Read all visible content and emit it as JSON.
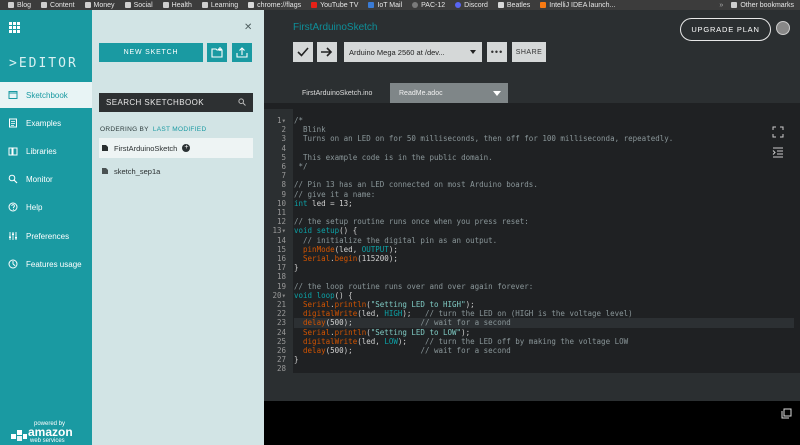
{
  "bookmarks": {
    "items": [
      {
        "label": "Blog",
        "icon": "folder-icon"
      },
      {
        "label": "Content",
        "icon": "folder-icon"
      },
      {
        "label": "Money",
        "icon": "folder-icon"
      },
      {
        "label": "Social",
        "icon": "folder-icon"
      },
      {
        "label": "Health",
        "icon": "folder-icon"
      },
      {
        "label": "Learning",
        "icon": "folder-icon"
      },
      {
        "label": "chrome://flags",
        "icon": "flask-icon"
      },
      {
        "label": "YouTube TV",
        "icon": "youtube-icon"
      },
      {
        "label": "IoT Mail",
        "icon": "mail-icon"
      },
      {
        "label": "PAC-12",
        "icon": "pac12-icon"
      },
      {
        "label": "Discord",
        "icon": "discord-icon"
      },
      {
        "label": "Beatles",
        "icon": "page-icon"
      },
      {
        "label": "IntelliJ IDEA launch...",
        "icon": "intellij-icon"
      }
    ],
    "overflow": "»",
    "other": "Other bookmarks"
  },
  "nav": {
    "brand": "EDITOR",
    "items": [
      {
        "label": "Sketchbook",
        "icon": "sketchbook-icon",
        "active": true
      },
      {
        "label": "Examples",
        "icon": "examples-icon",
        "active": false
      },
      {
        "label": "Libraries",
        "icon": "libraries-icon",
        "active": false
      },
      {
        "label": "Monitor",
        "icon": "monitor-icon",
        "active": false
      },
      {
        "label": "Help",
        "icon": "help-icon",
        "active": false
      },
      {
        "label": "Preferences",
        "icon": "preferences-icon",
        "active": false
      },
      {
        "label": "Features usage",
        "icon": "features-icon",
        "active": false
      }
    ],
    "aws": {
      "powered": "powered by",
      "brand": "amazon",
      "sub": "web services"
    }
  },
  "sidebar": {
    "close": "✕",
    "new_sketch": "NEW SKETCH",
    "search_placeholder": "SEARCH SKETCHBOOK",
    "ordering_label": "ORDERING BY",
    "ordering_value": "LAST MODIFIED",
    "sketches": [
      {
        "name": "FirstArduinoSketch",
        "active": true
      },
      {
        "name": "sketch_sep1a",
        "active": false
      }
    ]
  },
  "header": {
    "sketch_title": "FirstArduinoSketch",
    "upgrade": "UPGRADE PLAN",
    "board": "Arduino Mega 2560 at /dev...",
    "more": "•••",
    "share": "SHARE"
  },
  "tabs": [
    {
      "label": "FirstArduinoSketch.ino",
      "active": true
    },
    {
      "label": "ReadMe.adoc",
      "active": false
    }
  ],
  "editor": {
    "current_line": 23,
    "lines": [
      {
        "n": "1",
        "fold": true,
        "segs": [
          [
            "c-com",
            "/*"
          ]
        ]
      },
      {
        "n": "2",
        "segs": [
          [
            "c-com",
            "  Blink"
          ]
        ]
      },
      {
        "n": "3",
        "segs": [
          [
            "c-com",
            "  Turns on an LED on for 50 milliseconds, then off for 100 millisecondа, repeatedly."
          ]
        ]
      },
      {
        "n": "4",
        "segs": [
          [
            "c-com",
            ""
          ]
        ]
      },
      {
        "n": "5",
        "segs": [
          [
            "c-com",
            "  This example code is in the public domain."
          ]
        ]
      },
      {
        "n": "6",
        "segs": [
          [
            "c-com",
            " */"
          ]
        ]
      },
      {
        "n": "7",
        "segs": []
      },
      {
        "n": "8",
        "segs": [
          [
            "c-com",
            "// Pin 13 has an LED connected on most Arduino boards."
          ]
        ]
      },
      {
        "n": "9",
        "segs": [
          [
            "c-com",
            "// give it a name:"
          ]
        ]
      },
      {
        "n": "10",
        "segs": [
          [
            "c-key",
            "int"
          ],
          [
            "c-sym",
            " led = 13;"
          ]
        ]
      },
      {
        "n": "11",
        "segs": []
      },
      {
        "n": "12",
        "segs": [
          [
            "c-com",
            "// the setup routine runs once when you press reset:"
          ]
        ]
      },
      {
        "n": "13",
        "fold": true,
        "segs": [
          [
            "c-key",
            "void"
          ],
          [
            "c-sym",
            " "
          ],
          [
            "c-key",
            "setup"
          ],
          [
            "c-sym",
            "() {"
          ]
        ]
      },
      {
        "n": "14",
        "segs": [
          [
            "c-com",
            "  // initialize the digital pin as an output."
          ]
        ]
      },
      {
        "n": "15",
        "segs": [
          [
            "c-sym",
            "  "
          ],
          [
            "c-fn",
            "pinMode"
          ],
          [
            "c-sym",
            "(led, "
          ],
          [
            "c-key",
            "OUTPUT"
          ],
          [
            "c-sym",
            ");"
          ]
        ]
      },
      {
        "n": "16",
        "segs": [
          [
            "c-sym",
            "  "
          ],
          [
            "c-fn",
            "Serial"
          ],
          [
            "c-sym",
            "."
          ],
          [
            "c-fn",
            "begin"
          ],
          [
            "c-sym",
            "(115200);"
          ]
        ]
      },
      {
        "n": "17",
        "segs": [
          [
            "c-sym",
            "}"
          ]
        ]
      },
      {
        "n": "18",
        "segs": []
      },
      {
        "n": "19",
        "segs": [
          [
            "c-com",
            "// the loop routine runs over and over again forever:"
          ]
        ]
      },
      {
        "n": "20",
        "fold": true,
        "segs": [
          [
            "c-key",
            "void"
          ],
          [
            "c-sym",
            " "
          ],
          [
            "c-key",
            "loop"
          ],
          [
            "c-sym",
            "() {"
          ]
        ]
      },
      {
        "n": "21",
        "segs": [
          [
            "c-sym",
            "  "
          ],
          [
            "c-fn",
            "Serial"
          ],
          [
            "c-sym",
            "."
          ],
          [
            "c-fn",
            "println"
          ],
          [
            "c-sym",
            "("
          ],
          [
            "c-str",
            "\"Setting LED to HIGH\""
          ],
          [
            "c-sym",
            ");"
          ]
        ]
      },
      {
        "n": "22",
        "segs": [
          [
            "c-sym",
            "  "
          ],
          [
            "c-fn",
            "digitalWrite"
          ],
          [
            "c-sym",
            "(led, "
          ],
          [
            "c-key",
            "HIGH"
          ],
          [
            "c-sym",
            ");   "
          ],
          [
            "c-com",
            "// turn the LED on (HIGH is the voltage level)"
          ]
        ]
      },
      {
        "n": "23",
        "segs": [
          [
            "c-sym",
            "  "
          ],
          [
            "c-fn",
            "delay"
          ],
          [
            "c-sym",
            "(500);               "
          ],
          [
            "c-com",
            "// wait for a second"
          ]
        ]
      },
      {
        "n": "24",
        "segs": [
          [
            "c-sym",
            "  "
          ],
          [
            "c-fn",
            "Serial"
          ],
          [
            "c-sym",
            "."
          ],
          [
            "c-fn",
            "println"
          ],
          [
            "c-sym",
            "("
          ],
          [
            "c-str",
            "\"Setting LED to LOW\""
          ],
          [
            "c-sym",
            ");"
          ]
        ]
      },
      {
        "n": "25",
        "segs": [
          [
            "c-sym",
            "  "
          ],
          [
            "c-fn",
            "digitalWrite"
          ],
          [
            "c-sym",
            "(led, "
          ],
          [
            "c-key",
            "LOW"
          ],
          [
            "c-sym",
            ");    "
          ],
          [
            "c-com",
            "// turn the LED off by making the voltage LOW"
          ]
        ]
      },
      {
        "n": "26",
        "segs": [
          [
            "c-sym",
            "  "
          ],
          [
            "c-fn",
            "delay"
          ],
          [
            "c-sym",
            "(500);               "
          ],
          [
            "c-com",
            "// wait for a second"
          ]
        ]
      },
      {
        "n": "27",
        "segs": [
          [
            "c-sym",
            "}"
          ]
        ]
      },
      {
        "n": "28",
        "segs": []
      }
    ]
  },
  "colors": {
    "accent": "#1a9aa2",
    "sidebar_bg": "#d2e4e5",
    "editor_bg": "#1f2123",
    "keyword": "#0ca1a6",
    "function": "#d35400"
  }
}
